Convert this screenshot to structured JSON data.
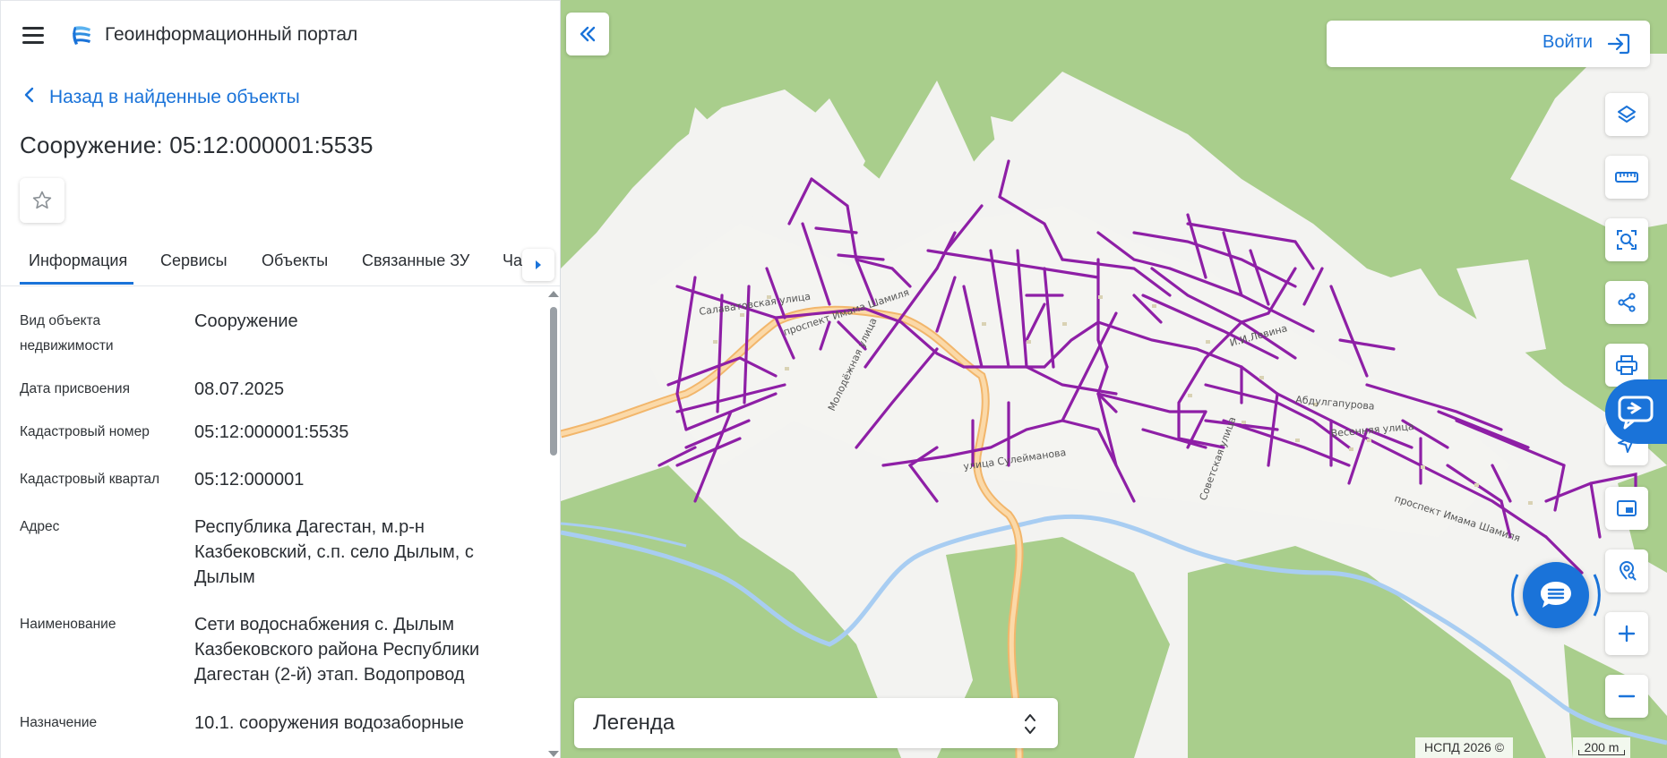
{
  "app": {
    "title": "Геоинформационный портал"
  },
  "nav": {
    "back_label": "Назад в найденные объекты"
  },
  "object": {
    "title": "Сооружение: 05:12:000001:5535"
  },
  "tabs": [
    {
      "label": "Информация",
      "active": true
    },
    {
      "label": "Сервисы",
      "active": false
    },
    {
      "label": "Объекты",
      "active": false
    },
    {
      "label": "Связанные ЗУ",
      "active": false
    },
    {
      "label": "Ча",
      "active": false
    }
  ],
  "info_rows": [
    {
      "label": "Вид объекта недвижимости",
      "value": "Сооружение"
    },
    {
      "label": "Дата присвоения",
      "value": "08.07.2025"
    },
    {
      "label": "Кадастровый номер",
      "value": "05:12:000001:5535"
    },
    {
      "label": "Кадастровый квартал",
      "value": "05:12:000001"
    },
    {
      "label": "Адрес",
      "value": "Республика Дагестан, м.р-н Казбековский, с.п. село Дылым, с Дылым"
    },
    {
      "label": "Наименование",
      "value": "Сети водоснабжения с. Дылым Казбековского района Республики Дагестан (2-й) этап. Водопровод"
    },
    {
      "label": "Назначение",
      "value": "10.1. сооружения водозаборные"
    }
  ],
  "map": {
    "login_label": "Войти",
    "legend_label": "Легенда",
    "attribution": "НСПД 2026 ©",
    "scale_label": "200 m",
    "street_labels": [
      "Салаватовская улица",
      "проспект Имама Шамиля",
      "улица Сулейманова",
      "Молодёжная улица",
      "И.И.Левина",
      "Советская улица",
      "Абдулгапурова",
      "Весенняя улица",
      "проспект Имама Шамиля"
    ]
  },
  "colors": {
    "accent": "#1a73d9",
    "network": "#8e1fa6",
    "forest": "#a9ce8c",
    "water": "#a8cdf2",
    "road": "#f6c98a"
  },
  "icons": {
    "menu": "hamburger-icon",
    "back": "chevron-left-icon",
    "favorite": "star-icon",
    "collapse": "double-chevron-left-icon",
    "login": "login-icon",
    "layers": "layers-icon",
    "ruler": "ruler-icon",
    "select": "area-select-icon",
    "share": "share-icon",
    "print": "print-icon",
    "location": "location-icon",
    "minimap": "minimap-icon",
    "geo-search": "geo-search-icon",
    "zoom_in": "plus-icon",
    "zoom_out": "minus-icon",
    "chat": "chat-icon"
  }
}
